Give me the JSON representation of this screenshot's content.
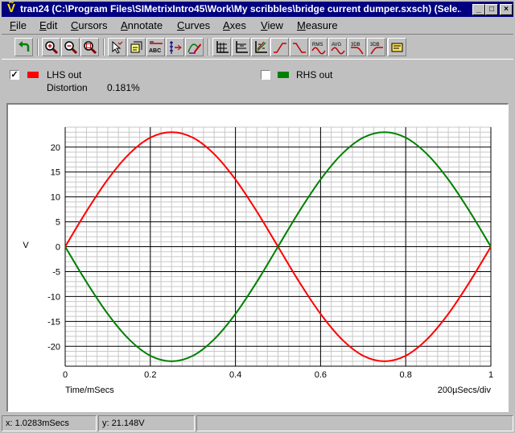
{
  "window": {
    "title": "tran24 (C:\\Program Files\\SIMetrixIntro45\\Work\\My scribbles\\bridge current dumper.sxsch) (Sele...",
    "controls": {
      "minimize": "_",
      "maximize": "□",
      "close": "×"
    }
  },
  "menu": [
    {
      "acc": "F",
      "rest": "ile"
    },
    {
      "acc": "E",
      "rest": "dit"
    },
    {
      "acc": "C",
      "rest": "ursors"
    },
    {
      "acc": "A",
      "rest": "nnotate"
    },
    {
      "acc": "C",
      "rest": "urves"
    },
    {
      "acc": "A",
      "rest": "xes"
    },
    {
      "acc": "V",
      "rest": "iew"
    },
    {
      "acc": "M",
      "rest": "easure"
    }
  ],
  "toolbar": {
    "buttons": [
      {
        "icon": "undo-arrow-icon"
      },
      {
        "icon": "zoom-in-icon"
      },
      {
        "icon": "zoom-out-icon"
      },
      {
        "icon": "zoom-full-icon"
      },
      {
        "icon": "cursor-pointer-icon"
      },
      {
        "icon": "annotate-icon"
      },
      {
        "icon": "text-abc-icon",
        "text": "ABC"
      },
      {
        "icon": "cursor-line-icon"
      },
      {
        "icon": "curve-pen-icon"
      },
      {
        "icon": "grid-axes-icon"
      },
      {
        "icon": "grid-lines-icon"
      },
      {
        "icon": "scatter-axes-icon"
      },
      {
        "icon": "rise-time-icon"
      },
      {
        "icon": "fall-time-icon"
      },
      {
        "icon": "rms-icon",
        "text": "RMS"
      },
      {
        "icon": "avg-icon",
        "text": "AVG"
      },
      {
        "icon": "3db-lowpass-icon",
        "text": "3DB"
      },
      {
        "icon": "3db-highpass-icon",
        "text": "3DB"
      },
      {
        "icon": "properties-icon"
      }
    ]
  },
  "legend": {
    "lhs": {
      "label": "LHS out",
      "checked": true,
      "color": "#ff0000",
      "check_mark": "✓"
    },
    "rhs": {
      "label": "RHS out",
      "checked": false,
      "color": "#008000"
    },
    "measure_label": "Distortion",
    "measure_value": "0.181%"
  },
  "status": {
    "x": "x: 1.0283mSecs",
    "y": "y: 21.148V"
  },
  "chart_data": {
    "type": "line",
    "xlabel": "Time/mSecs",
    "ylabel": "V",
    "annotation": "200µSecs/div",
    "xlim": [
      0,
      1
    ],
    "ylim": [
      -24,
      24
    ],
    "xticks": [
      0,
      0.2,
      0.4,
      0.6,
      0.8,
      1
    ],
    "yticks": [
      20,
      15,
      10,
      5,
      0,
      -5,
      -10,
      -15,
      -20
    ],
    "grid": true,
    "series": [
      {
        "name": "LHS out",
        "color": "#ff0000",
        "x": [
          0,
          0.05,
          0.1,
          0.15,
          0.2,
          0.25,
          0.3,
          0.35,
          0.4,
          0.45,
          0.5,
          0.55,
          0.6,
          0.65,
          0.7,
          0.75,
          0.8,
          0.85,
          0.9,
          0.95,
          1
        ],
        "y": [
          0,
          7.1,
          13.5,
          18.6,
          21.9,
          23.0,
          21.9,
          18.6,
          13.5,
          7.1,
          0,
          -7.1,
          -13.5,
          -18.6,
          -21.9,
          -23.0,
          -21.9,
          -18.6,
          -13.5,
          -7.1,
          0
        ]
      },
      {
        "name": "RHS out",
        "color": "#008000",
        "x": [
          0,
          0.05,
          0.1,
          0.15,
          0.2,
          0.25,
          0.3,
          0.35,
          0.4,
          0.45,
          0.5,
          0.55,
          0.6,
          0.65,
          0.7,
          0.75,
          0.8,
          0.85,
          0.9,
          0.95,
          1
        ],
        "y": [
          0,
          -7.1,
          -13.5,
          -18.6,
          -21.9,
          -23.0,
          -21.9,
          -18.6,
          -13.5,
          -7.1,
          0,
          7.1,
          13.5,
          18.6,
          21.9,
          23.0,
          21.9,
          18.6,
          13.5,
          7.1,
          0
        ]
      }
    ]
  }
}
